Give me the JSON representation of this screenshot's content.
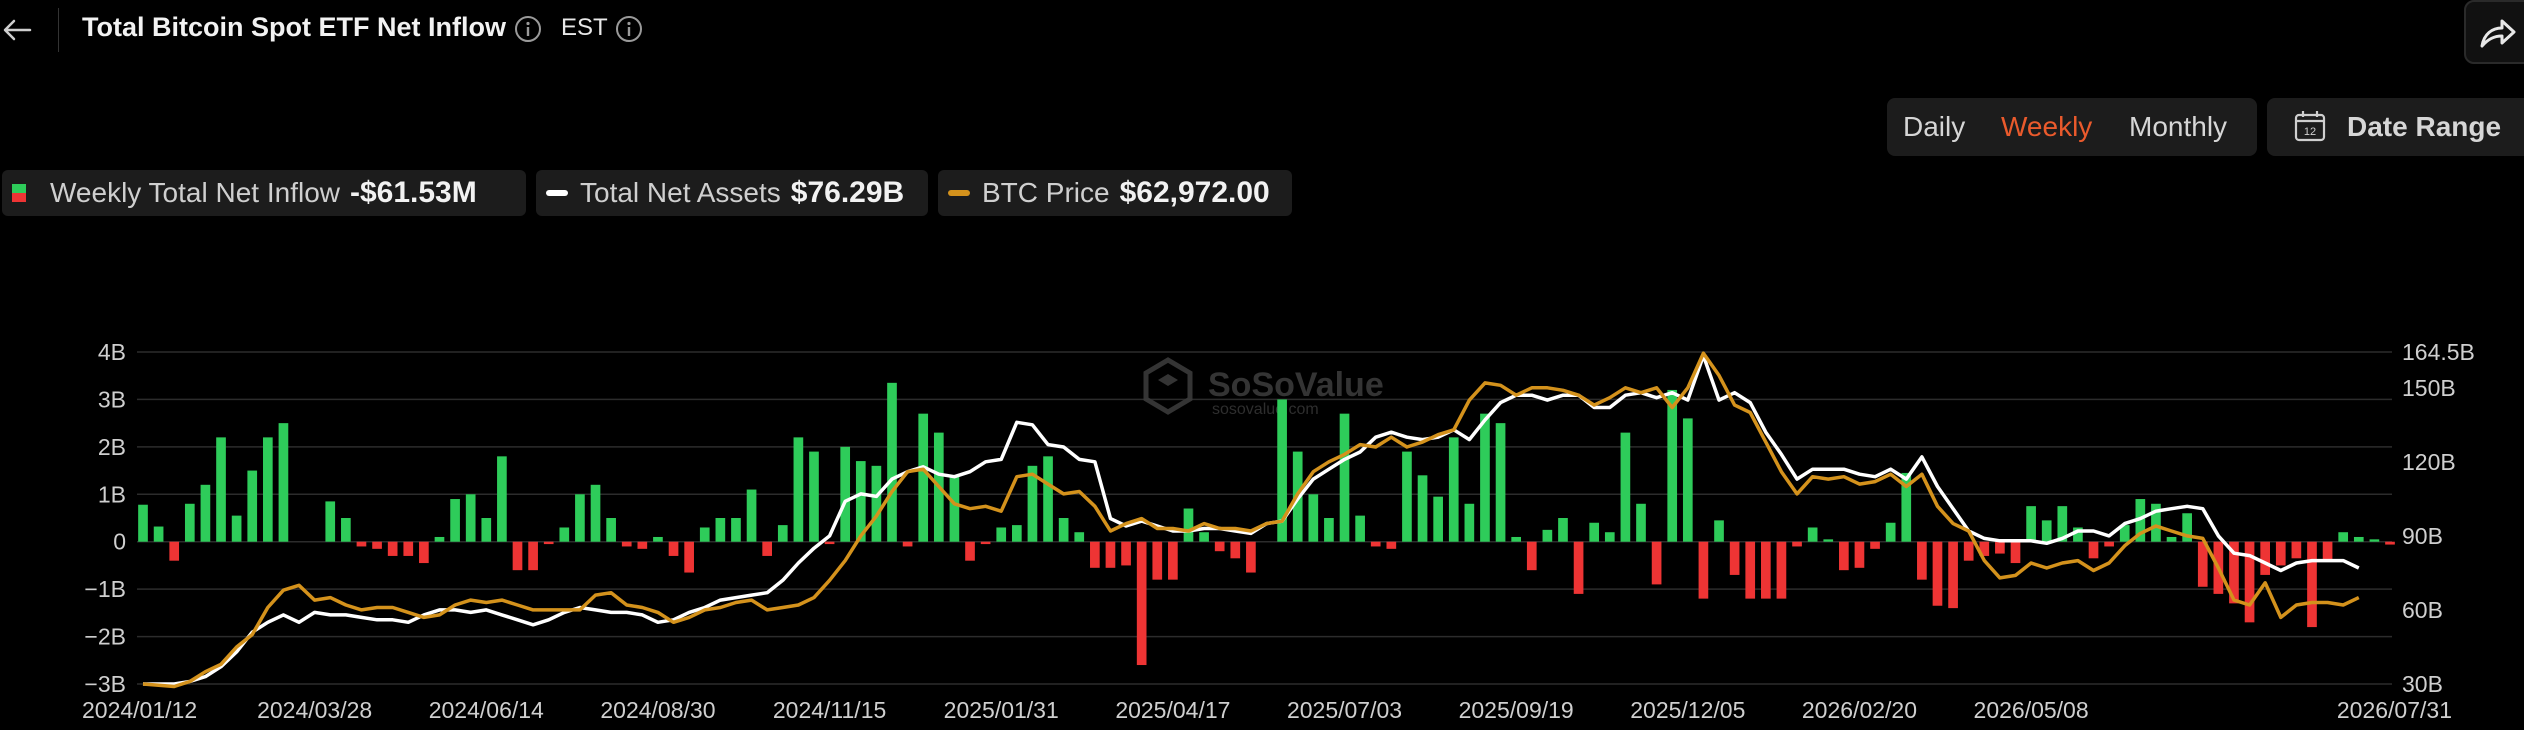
{
  "header": {
    "title": "Total Bitcoin Spot ETF Net Inflow",
    "timezone": "EST"
  },
  "controls": {
    "periods": [
      "Daily",
      "Weekly",
      "Monthly"
    ],
    "active_period": "Weekly",
    "date_range_label": "Date Range"
  },
  "legend": {
    "inflow_label": "Weekly Total Net Inflow",
    "inflow_value": "-$61.53M",
    "assets_label": "Total Net Assets",
    "assets_value": "$76.29B",
    "price_label": "BTC Price",
    "price_value": "$62,972.00"
  },
  "watermark": {
    "name": "SoSoValue",
    "site": "sosovalue.com"
  },
  "colors": {
    "positive": "#2ecc5a",
    "negative": "#ee3434",
    "assets_line": "#ffffff",
    "price_line": "#d4921c",
    "active_period": "#ea5a2c"
  },
  "chart_data": {
    "type": "bar",
    "x_tick_labels": [
      "2024/01/12",
      "2024/03/28",
      "2024/06/14",
      "2024/08/30",
      "2024/11/15",
      "2025/01/31",
      "2025/04/17",
      "2025/07/03",
      "2025/09/19",
      "2025/12/05",
      "2026/02/20",
      "2026/05/08",
      "2026/07/31"
    ],
    "x_tick_index": [
      0,
      11,
      22,
      33,
      44,
      55,
      66,
      77,
      88,
      99,
      110,
      121,
      133
    ],
    "left_axis": {
      "ticks": [
        "4B",
        "3B",
        "2B",
        "1B",
        "0",
        "−1B",
        "−2B",
        "−3B"
      ],
      "ylim": [
        -3,
        4
      ],
      "unit": "B USD"
    },
    "right_axis": {
      "ticks": [
        "164.5B",
        "150B",
        "120B",
        "90B",
        "60B",
        "30B"
      ],
      "values": [
        164.5,
        150,
        120,
        90,
        60,
        30
      ],
      "ylim": [
        30,
        164.5
      ]
    },
    "series": [
      {
        "name": "Weekly Total Net Inflow",
        "axis": "left",
        "kind": "bar",
        "values": [
          0.78,
          0.32,
          -0.4,
          0.8,
          1.2,
          2.2,
          0.55,
          1.5,
          2.2,
          2.5,
          0,
          0,
          0.85,
          0.5,
          -0.1,
          -0.15,
          -0.3,
          -0.3,
          -0.45,
          0.1,
          0.9,
          1.0,
          0.5,
          1.8,
          -0.6,
          -0.6,
          -0.05,
          0.3,
          1.0,
          1.2,
          0.5,
          -0.1,
          -0.15,
          0.1,
          -0.3,
          -0.65,
          0.3,
          0.5,
          0.5,
          1.1,
          -0.3,
          0.35,
          2.2,
          1.9,
          -0.05,
          2.0,
          1.7,
          1.6,
          3.35,
          -0.1,
          2.7,
          2.3,
          1.4,
          -0.4,
          -0.05,
          0.3,
          0.35,
          1.6,
          1.8,
          0.5,
          0.2,
          -0.55,
          -0.55,
          -0.5,
          -2.6,
          -0.8,
          -0.8,
          0.7,
          0.2,
          -0.2,
          -0.35,
          -0.65,
          0,
          3.0,
          1.9,
          1.0,
          0.5,
          2.7,
          0.55,
          -0.1,
          -0.15,
          1.9,
          1.4,
          0.95,
          2.2,
          0.8,
          2.7,
          2.5,
          0.1,
          -0.6,
          0.25,
          0.5,
          -1.1,
          0.4,
          0.2,
          2.3,
          0.8,
          -0.9,
          3.2,
          2.6,
          -1.2,
          0.45,
          -0.7,
          -1.2,
          -1.2,
          -1.2,
          -0.1,
          0.3,
          0.05,
          -0.6,
          -0.55,
          -0.15,
          0.4,
          1.45,
          -0.8,
          -1.35,
          -1.4,
          -0.4,
          -0.3,
          -0.25,
          -0.45,
          0.75,
          0.45,
          0.75,
          0.3,
          -0.35,
          -0.1,
          0.35,
          0.9,
          0.8,
          0.1,
          0.6,
          -0.95,
          -1.1,
          -1.3,
          -1.7,
          -0.7,
          -0.5,
          -0.35,
          -1.8,
          -0.4,
          0.2,
          0.1,
          0.05,
          -0.06
        ]
      },
      {
        "name": "Total Net Assets",
        "axis": "right",
        "kind": "line",
        "values": [
          30,
          30,
          30,
          31,
          33,
          37,
          43,
          51,
          55,
          58,
          55,
          59,
          58,
          58,
          57,
          56,
          56,
          55,
          58,
          60,
          60,
          59,
          60,
          58,
          56,
          54,
          56,
          59,
          61,
          60,
          59,
          59,
          58,
          55,
          56,
          59,
          61,
          64,
          65,
          66,
          67,
          72,
          79,
          85,
          90,
          104,
          107,
          106,
          113,
          116,
          118,
          115,
          114,
          116,
          120,
          121,
          136,
          135,
          127,
          126,
          121,
          120,
          97,
          94,
          96,
          94,
          92,
          92,
          93,
          93,
          92,
          91,
          95,
          96,
          105,
          113,
          117,
          121,
          124,
          130,
          132,
          130,
          129,
          130,
          133,
          129,
          137,
          144,
          147,
          147,
          145,
          147,
          147,
          142,
          142,
          147,
          148,
          146,
          148,
          145,
          163,
          145,
          148,
          144,
          132,
          123,
          113,
          117,
          117,
          117,
          115,
          114,
          117,
          113,
          122,
          110,
          101,
          92,
          89,
          88,
          88,
          88,
          87,
          89,
          92,
          92,
          90,
          95,
          97,
          100,
          101,
          102,
          101,
          90,
          83,
          82,
          79,
          76,
          79,
          80,
          80,
          80,
          77
        ]
      },
      {
        "name": "BTC Price",
        "axis": "right",
        "kind": "line",
        "values": [
          30,
          29.5,
          29,
          31,
          35,
          38,
          45,
          50,
          61,
          68,
          70,
          64,
          65,
          62,
          60,
          61,
          61,
          59,
          57,
          58,
          62,
          64,
          63,
          64,
          62,
          60,
          60,
          60,
          60,
          66,
          67,
          62,
          61,
          59,
          55,
          57,
          60,
          61,
          63,
          64,
          60,
          61,
          62,
          65,
          72,
          80,
          90,
          98,
          108,
          116,
          117,
          110,
          103,
          101,
          102,
          100,
          114,
          115,
          111,
          107,
          108,
          102,
          92,
          95,
          97,
          93,
          93,
          92,
          95,
          93,
          93,
          92,
          95,
          96,
          107,
          116,
          120,
          123,
          127,
          126,
          130,
          126,
          128,
          131,
          133,
          145,
          152,
          151,
          147,
          150,
          150,
          149,
          147,
          143,
          146,
          150,
          148,
          150,
          142,
          150,
          164,
          155,
          143,
          140,
          128,
          116,
          107,
          114,
          113,
          114,
          111,
          112,
          115,
          110,
          115,
          102,
          95,
          92,
          80,
          73,
          74,
          79,
          77,
          79,
          80,
          76,
          79,
          86,
          91,
          94,
          92,
          90,
          89,
          77,
          64,
          62,
          71,
          57,
          62,
          63,
          63,
          62,
          65
        ]
      }
    ]
  }
}
